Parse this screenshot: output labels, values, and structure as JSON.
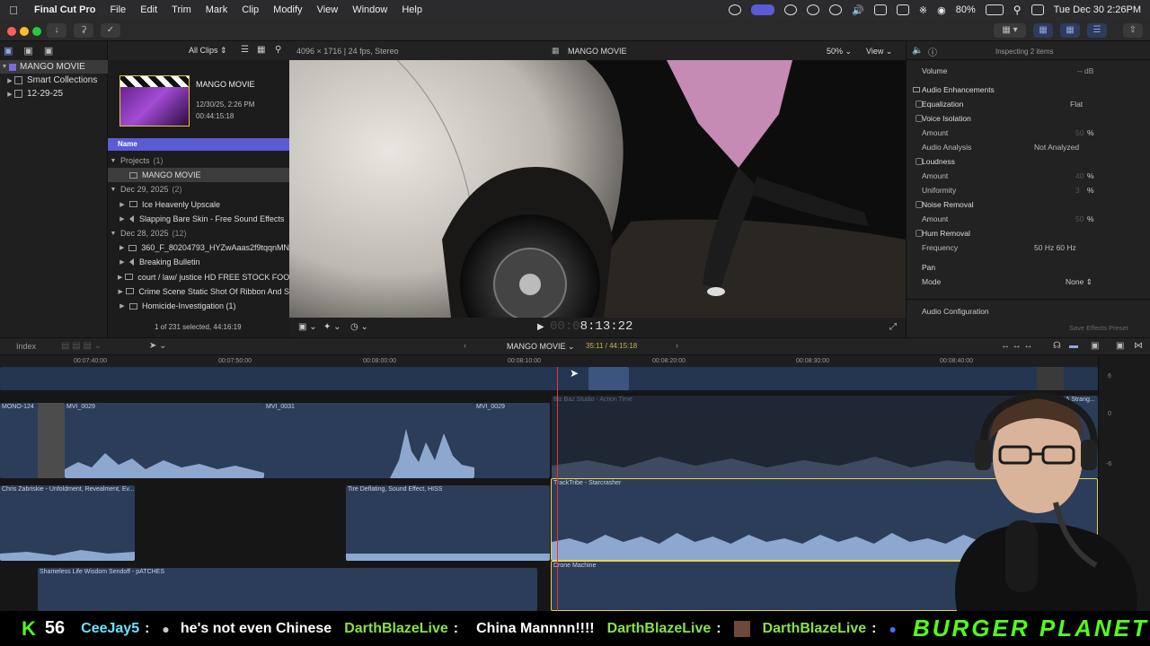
{
  "menubar": {
    "app_name": "Final Cut Pro",
    "items": [
      "File",
      "Edit",
      "Trim",
      "Mark",
      "Clip",
      "Modify",
      "View",
      "Window",
      "Help"
    ],
    "battery": "80%",
    "datetime": "Tue Dec 30  2:26PM"
  },
  "sidebar": {
    "items": [
      {
        "label": "MANGO MOVIE",
        "selected": true
      },
      {
        "label": "Smart Collections"
      },
      {
        "label": "12-29-25"
      }
    ]
  },
  "browser": {
    "filter_label": "All Clips",
    "project_card": {
      "title": "MANGO MOVIE",
      "date": "12/30/25, 2:26 PM",
      "duration": "00:44:15:18"
    },
    "column_header": "Name",
    "rows": [
      {
        "type": "group",
        "label": "Projects",
        "count": "(1)"
      },
      {
        "type": "item",
        "label": "MANGO MOVIE",
        "icon": "project",
        "selected": true
      },
      {
        "type": "group",
        "label": "Dec 29, 2025",
        "count": "(2)"
      },
      {
        "type": "item",
        "label": "Ice Heavenly Upscale",
        "icon": "clip"
      },
      {
        "type": "item",
        "label": "Slapping Bare Skin - Free Sound Effects",
        "icon": "audio"
      },
      {
        "type": "group",
        "label": "Dec 28, 2025",
        "count": "(12)"
      },
      {
        "type": "item",
        "label": "360_F_80204793_HYZwAaas2f9tqqnMN",
        "icon": "clip"
      },
      {
        "type": "item",
        "label": "Breaking Bulletin",
        "icon": "audio"
      },
      {
        "type": "item",
        "label": "court / law/ justice HD FREE STOCK FOO",
        "icon": "clip"
      },
      {
        "type": "item",
        "label": "Crime Scene Static Shot Of Ribbon And S",
        "icon": "clip"
      },
      {
        "type": "item",
        "label": "Homicide-Investigation (1)",
        "icon": "clip"
      }
    ],
    "selection_status": "1 of 231 selected, 44:16:19"
  },
  "viewer": {
    "format": "4096 × 1716 | 24 fps, Stereo",
    "title": "MANGO MOVIE",
    "zoom": "50%",
    "view_label": "View",
    "timecode": "8:13:22"
  },
  "inspector": {
    "header": "Inspecting 2 items",
    "volume_label": "Volume",
    "volume_value": "-- dB",
    "section": "Audio Enhancements",
    "rows": [
      {
        "label": "Equalization",
        "checkbox": true,
        "value": "Flat"
      },
      {
        "label": "Voice Isolation",
        "checkbox": true,
        "value": ""
      },
      {
        "label": "Amount",
        "checkbox": false,
        "value": "50",
        "unit": "%"
      },
      {
        "label": "Audio Analysis",
        "checkbox": false,
        "value": "Not Analyzed"
      },
      {
        "label": "Loudness",
        "checkbox": true,
        "value": ""
      },
      {
        "label": "Amount",
        "checkbox": false,
        "value": "40",
        "unit": "%"
      },
      {
        "label": "Uniformity",
        "checkbox": false,
        "value": "3",
        "unit": "%"
      },
      {
        "label": "Noise Removal",
        "checkbox": true,
        "value": ""
      },
      {
        "label": "Amount",
        "checkbox": false,
        "value": "50",
        "unit": "%"
      },
      {
        "label": "Hum Removal",
        "checkbox": true,
        "value": ""
      },
      {
        "label": "Frequency",
        "checkbox": false,
        "value": "50 Hz   60 Hz"
      }
    ],
    "pan_label": "Pan",
    "mode_label": "Mode",
    "mode_value": "None",
    "audio_config": "Audio Configuration",
    "save_preset": "Save Effects Preset"
  },
  "timeline": {
    "index_label": "Index",
    "project_name": "MANGO MOVIE",
    "position": "35:11 / 44:15:18",
    "ruler_ticks": [
      "00:07:40:00",
      "00:07:50:00",
      "00:08:00:00",
      "00:08:10:00",
      "00:08:20:00",
      "00:08:30:00",
      "00:08:40:00"
    ],
    "meter_scale": [
      "6",
      "0",
      "-6"
    ],
    "clips": [
      {
        "name": "MONO-124"
      },
      {
        "name": "MVI_0029"
      },
      {
        "name": "MVI_0031"
      },
      {
        "name": "MVI_0029"
      },
      {
        "name": "Biz Baz Studio - Action Time"
      },
      {
        "name": "A Strang..."
      },
      {
        "name": "Chris Zabriskie - Unfoldment, Revealment, Ev..."
      },
      {
        "name": "Tire Deflating, Sound Effect, HISS"
      },
      {
        "name": "TrackTribe - Starcrasher"
      },
      {
        "name": "Shameless Life Wisdom Sendoff - pATCHES"
      },
      {
        "name": "Drone Machine"
      }
    ]
  },
  "overlay": {
    "counter_icon": "K",
    "counter_value": "56",
    "chat": [
      {
        "user": "CeeJay5",
        "msg": "he's not even Chinese"
      },
      {
        "user": "DarthBlazeLive",
        "msg": "China Mannnn!!!!"
      },
      {
        "user": "DarthBlazeLive",
        "msg": ""
      },
      {
        "user": "DarthBlazeLive",
        "msg": ""
      }
    ],
    "banner": "BURGER PLANET"
  }
}
